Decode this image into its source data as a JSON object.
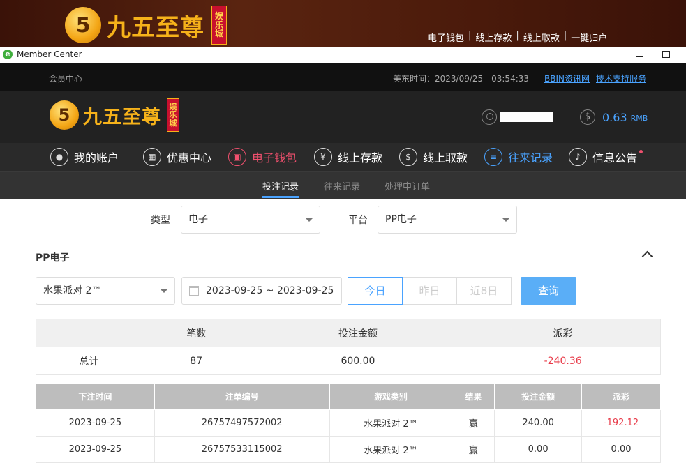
{
  "banner": {
    "logo_mark": "5",
    "logo_text": "九五至尊",
    "logo_badge": [
      "娱",
      "乐",
      "城"
    ],
    "links": [
      "电子钱包",
      "线上存款",
      "线上取款",
      "一键归户"
    ]
  },
  "window": {
    "title": "Member Center"
  },
  "topbar": {
    "member_center": "会员中心",
    "time": "美东时间：2023/09/25 - 03:54:33",
    "link_bbin": "BBIN资讯网",
    "link_support": "技术支持服务"
  },
  "header": {
    "logo_text": "九五至尊",
    "logo_badge": [
      "娱",
      "乐",
      "城"
    ],
    "balance": "0.63",
    "currency": "RMB"
  },
  "nav": {
    "items": [
      {
        "label": "我的账户",
        "icon": "user-icon"
      },
      {
        "label": "优惠中心",
        "icon": "gift-icon"
      },
      {
        "label": "电子钱包",
        "icon": "wallet-icon"
      },
      {
        "label": "线上存款",
        "icon": "deposit-icon"
      },
      {
        "label": "线上取款",
        "icon": "withdraw-icon"
      },
      {
        "label": "往来记录",
        "icon": "record-icon"
      },
      {
        "label": "信息公告",
        "icon": "bell-icon"
      }
    ]
  },
  "subnav": {
    "tabs": [
      "投注记录",
      "往来记录",
      "处理中订单"
    ]
  },
  "filters": {
    "type_label": "类型",
    "type_value": "电子",
    "platform_label": "平台",
    "platform_value": "PP电子"
  },
  "section": {
    "title": "PP电子",
    "game_value": "水果派对 2™",
    "date_range": "2023-09-25 ~ 2023-09-25",
    "quick_buttons": [
      "今日",
      "昨日",
      "近8日"
    ],
    "query": "查询"
  },
  "summary": {
    "headers": [
      "",
      "笔数",
      "投注金额",
      "派彩"
    ],
    "row": [
      "总计",
      "87",
      "600.00",
      "-240.36"
    ]
  },
  "records": {
    "headers": [
      "下注时间",
      "注单编号",
      "游戏类别",
      "结果",
      "投注金额",
      "派彩"
    ],
    "rows": [
      [
        "2023-09-25",
        "26757497572002",
        "水果派对 2™",
        "赢",
        "240.00",
        "-192.12"
      ],
      [
        "2023-09-25",
        "26757533115002",
        "水果派对 2™",
        "赢",
        "0.00",
        "0.00"
      ]
    ]
  },
  "colors": {
    "accent": "#4aa3ff",
    "negative": "#e83c4a",
    "wallet_active": "#f0506e"
  }
}
